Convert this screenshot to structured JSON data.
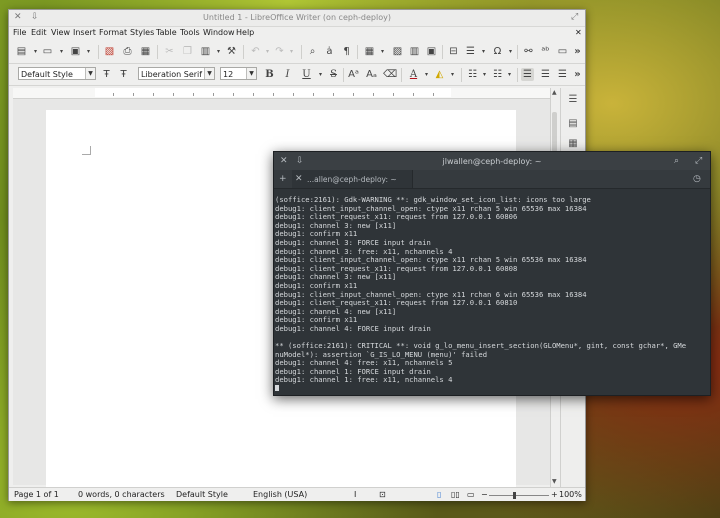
{
  "writer": {
    "title": "Untitled 1 - LibreOffice Writer (on ceph-deploy)",
    "menu": [
      "File",
      "Edit",
      "View",
      "Insert",
      "Format",
      "Styles",
      "Table",
      "Tools",
      "Window",
      "Help"
    ],
    "paragraph_style": "Default Style",
    "font_name": "Liberation Serif",
    "font_size": "12",
    "status": {
      "page": "Page 1 of 1",
      "words": "0 words, 0 characters",
      "style": "Default Style",
      "language": "English (USA)",
      "zoom": "100%"
    }
  },
  "terminal": {
    "title": "jlwallen@ceph-deploy: ~",
    "tab_label": "...allen@ceph-deploy: ~",
    "lines": [
      "(soffice:2161): Gdk-WARNING **: gdk_window_set_icon_list: icons too large",
      "debug1: client_input_channel_open: ctype x11 rchan 5 win 65536 max 16384",
      "debug1: client_request_x11: request from 127.0.0.1 60806",
      "debug1: channel 3: new [x11]",
      "debug1: confirm x11",
      "debug1: channel 3: FORCE input drain",
      "debug1: channel 3: free: x11, nchannels 4",
      "debug1: client_input_channel_open: ctype x11 rchan 5 win 65536 max 16384",
      "debug1: client_request_x11: request from 127.0.0.1 60808",
      "debug1: channel 3: new [x11]",
      "debug1: confirm x11",
      "debug1: client_input_channel_open: ctype x11 rchan 6 win 65536 max 16384",
      "debug1: client_request_x11: request from 127.0.0.1 60810",
      "debug1: channel 4: new [x11]",
      "debug1: confirm x11",
      "debug1: channel 4: FORCE input drain",
      "",
      "** (soffice:2161): CRITICAL **: void g_lo_menu_insert_section(GLOMenu*, gint, const gchar*, GMe",
      "nuModel*): assertion `G_IS_LO_MENU (menu)' failed",
      "debug1: channel 4: free: x11, nchannels 5",
      "debug1: channel 1: FORCE input drain",
      "debug1: channel 1: free: x11, nchannels 4"
    ]
  }
}
